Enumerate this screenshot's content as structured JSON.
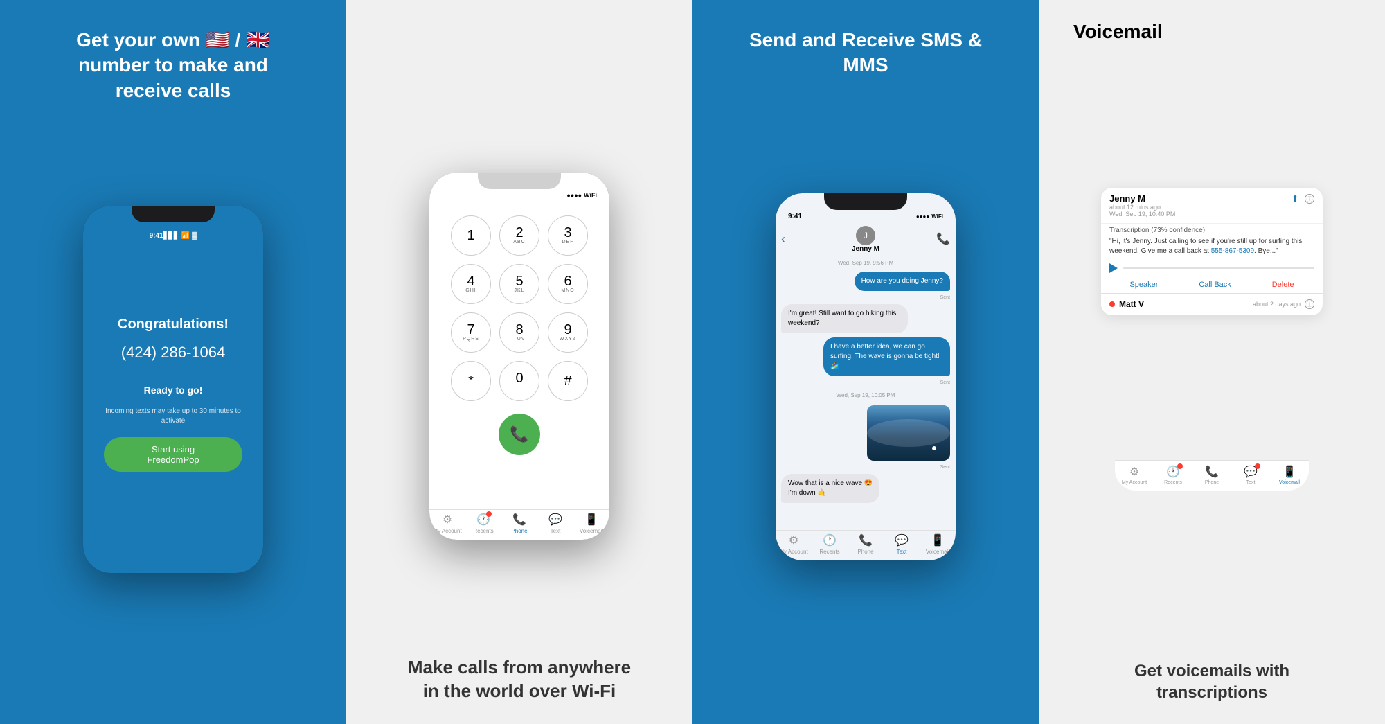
{
  "panels": [
    {
      "id": "panel-1",
      "headline": "Get your own 🇺🇸 / 🇬🇧 number\nto make and receive calls",
      "subtext": null,
      "screen": {
        "time": "9:41",
        "congratulations": "Congratulations!",
        "phone_number": "(424) 286-1064",
        "ready": "Ready to go!",
        "incoming_note": "Incoming texts may take up to 30 minutes\nto activate",
        "cta_label": "Start using FreedomPop"
      }
    },
    {
      "id": "panel-2",
      "headline": null,
      "subtext": "Make calls from anywhere\nin the world over Wi-Fi",
      "dialer": {
        "keys": [
          {
            "num": "1",
            "letters": ""
          },
          {
            "num": "2",
            "letters": "ABC"
          },
          {
            "num": "3",
            "letters": "DEF"
          },
          {
            "num": "4",
            "letters": "GHI"
          },
          {
            "num": "5",
            "letters": "JKL"
          },
          {
            "num": "6",
            "letters": "MNO"
          },
          {
            "num": "7",
            "letters": "PQRS"
          },
          {
            "num": "8",
            "letters": "TUV"
          },
          {
            "num": "9",
            "letters": "WXYZ"
          },
          {
            "num": "*",
            "letters": ""
          },
          {
            "num": "0",
            "letters": "·"
          },
          {
            "num": "#",
            "letters": ""
          }
        ],
        "tabs": [
          {
            "label": "My Account",
            "icon": "⚙",
            "active": false,
            "badge": false
          },
          {
            "label": "Recents",
            "icon": "🕐",
            "active": false,
            "badge": true
          },
          {
            "label": "Phone",
            "icon": "📞",
            "active": true,
            "badge": false
          },
          {
            "label": "Text",
            "icon": "💬",
            "active": false,
            "badge": false
          },
          {
            "label": "Voicemail",
            "icon": "📱",
            "active": false,
            "badge": false
          }
        ]
      }
    },
    {
      "id": "panel-3",
      "headline": "Send and Receive\nSMS & MMS",
      "screen": {
        "time": "9:41",
        "contact_name": "Jenny M",
        "date_header": "Wed, Sep 19, 9:56 PM",
        "messages": [
          {
            "text": "How are you doing Jenny?",
            "type": "outgoing",
            "label": "Sent"
          },
          {
            "text": "I'm great! Still want to go hiking this weekend?",
            "type": "incoming",
            "label": ""
          },
          {
            "text": "I have a better idea, we can go surfing. The wave is gonna be tight! 🏄‍♀️",
            "type": "outgoing",
            "label": "Sent"
          },
          {
            "type": "image",
            "label": "Sent"
          },
          {
            "text": "Wow that is a nice wave 😍\nI'm down 🤙",
            "type": "incoming",
            "label": ""
          }
        ],
        "date_header2": "Wed, Sep 19, 10:05 PM",
        "tabs": [
          {
            "label": "My Account",
            "icon": "⚙",
            "active": false,
            "badge": false
          },
          {
            "label": "Recents",
            "icon": "🕐",
            "active": false,
            "badge": false
          },
          {
            "label": "Phone",
            "icon": "📞",
            "active": false,
            "badge": false
          },
          {
            "label": "Text",
            "icon": "💬",
            "active": true,
            "badge": false
          },
          {
            "label": "Voicemail",
            "icon": "📱",
            "active": false,
            "badge": false
          }
        ]
      }
    },
    {
      "id": "panel-4",
      "headline": "Get voicemails with\ntranscriptions",
      "voicemail": {
        "title": "Voicemail",
        "contact1": {
          "name": "Jenny M",
          "time_ago": "about 12 mins ago",
          "date": "Wed, Sep 19, 10:40 PM",
          "transcription_label": "Transcription (73% confidence)",
          "transcript": "\"Hi, it's Jenny. Just calling to see if you're still up for surfing this weekend. Give me a call back at 555-867-5309. Bye...\"",
          "phone_link": "555-867-5309",
          "actions": [
            "Speaker",
            "Call Back",
            "Delete"
          ]
        },
        "contact2": {
          "name": "Matt V",
          "time_ago": "about 2 days ago",
          "unread": true
        },
        "tabs": [
          {
            "label": "My Account",
            "icon": "⚙",
            "active": false,
            "badge": false
          },
          {
            "label": "Recents",
            "icon": "🕐",
            "active": false,
            "badge": true
          },
          {
            "label": "Phone",
            "icon": "📞",
            "active": false,
            "badge": false
          },
          {
            "label": "Text",
            "icon": "💬",
            "active": false,
            "badge": true
          },
          {
            "label": "Voicemail",
            "icon": "📱",
            "active": true,
            "badge": false
          }
        ]
      }
    }
  ]
}
